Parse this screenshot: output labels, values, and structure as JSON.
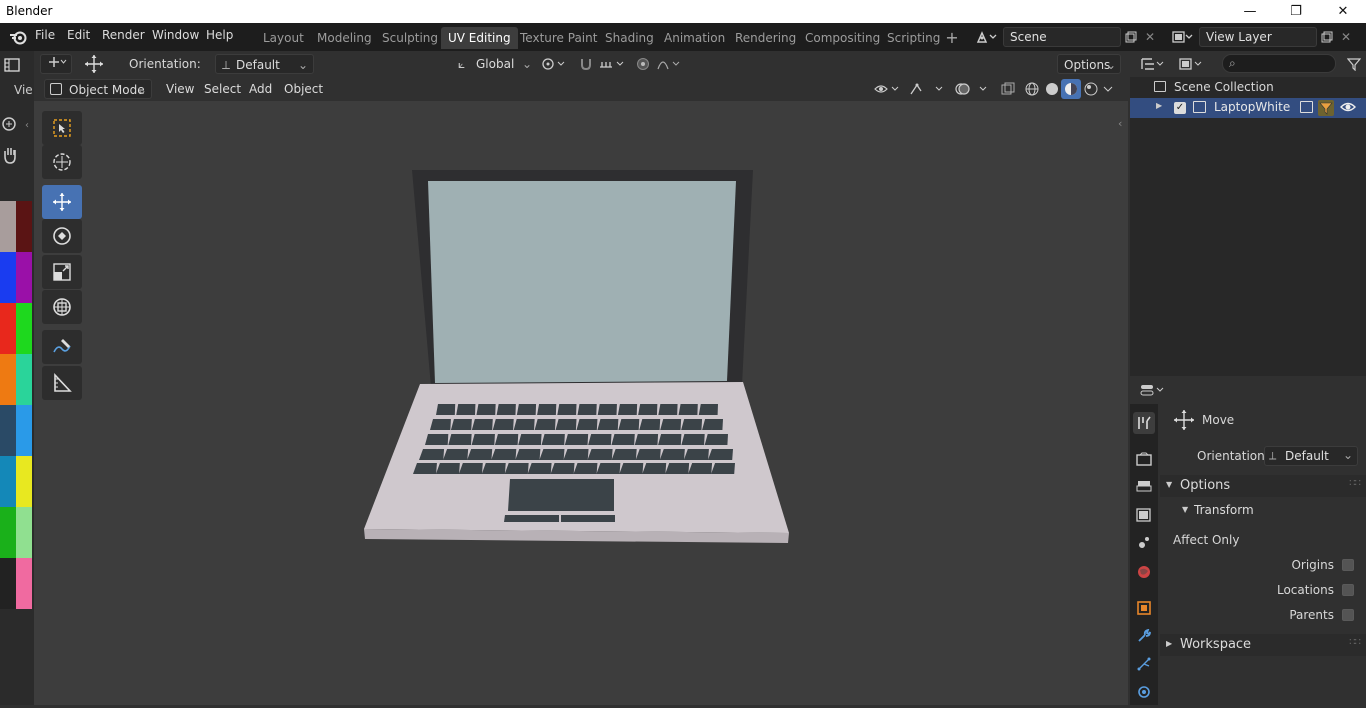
{
  "window": {
    "title": "Blender",
    "controls": {
      "minimize": "—",
      "maximize": "❐",
      "close": "✕"
    }
  },
  "menu": [
    "File",
    "Edit",
    "Render",
    "Window",
    "Help"
  ],
  "workspace_tabs": [
    "Layout",
    "Modeling",
    "Sculpting",
    "UV Editing",
    "Texture Paint",
    "Shading",
    "Animation",
    "Rendering",
    "Compositing",
    "Scripting"
  ],
  "active_workspace": "UV Editing",
  "scene": {
    "name": "Scene",
    "view_layer": "View Layer"
  },
  "tool_header": {
    "orientation_label": "Orientation:",
    "orientation_value": "Default",
    "transform_space": "Global",
    "options_label": "Options"
  },
  "viewport_header": {
    "mode": "Object Mode",
    "menus": [
      "View",
      "Select",
      "Add",
      "Object"
    ]
  },
  "left_strip": {
    "label": "Vie"
  },
  "palette_colors": [
    [
      "#a89d9c",
      "#5a1414"
    ],
    [
      "#1a3cf0",
      "#9a10a8"
    ],
    [
      "#e8281c",
      "#1ed81e"
    ],
    [
      "#ee7a12",
      "#2ad49a"
    ],
    [
      "#2a4a66",
      "#2a9ae8"
    ],
    [
      "#1488b8",
      "#e8e820"
    ],
    [
      "#1ab01a",
      "#90e090"
    ],
    [
      "#222222",
      "#f06aa0"
    ]
  ],
  "tools": [
    {
      "name": "select-box-tool",
      "active": false
    },
    {
      "name": "cursor-tool",
      "active": false
    },
    {
      "name": "move-tool",
      "active": true
    },
    {
      "name": "rotate-tool",
      "active": false
    },
    {
      "name": "scale-tool",
      "active": false
    },
    {
      "name": "transform-tool",
      "active": false
    },
    {
      "name": "annotate-tool",
      "active": false
    },
    {
      "name": "measure-tool",
      "active": false
    }
  ],
  "outliner": {
    "root": "Scene Collection",
    "items": [
      {
        "label": "LaptopWhite",
        "selected": true
      }
    ]
  },
  "properties": {
    "tool_name": "Move",
    "orientation_label": "Orientation",
    "orientation_value": "Default",
    "options_section": "Options",
    "transform_subsection": "Transform",
    "affect_only_label": "Affect Only",
    "checks": [
      {
        "label": "Origins",
        "checked": false
      },
      {
        "label": "Locations",
        "checked": false
      },
      {
        "label": "Parents",
        "checked": false
      }
    ],
    "workspace_section": "Workspace"
  },
  "colors": {
    "accent_blue": "#4772b3",
    "selected_row": "#334d80",
    "laptop_body": "#cfc8cd",
    "screen": "#9fb0b3",
    "keys": "#3b4348"
  }
}
